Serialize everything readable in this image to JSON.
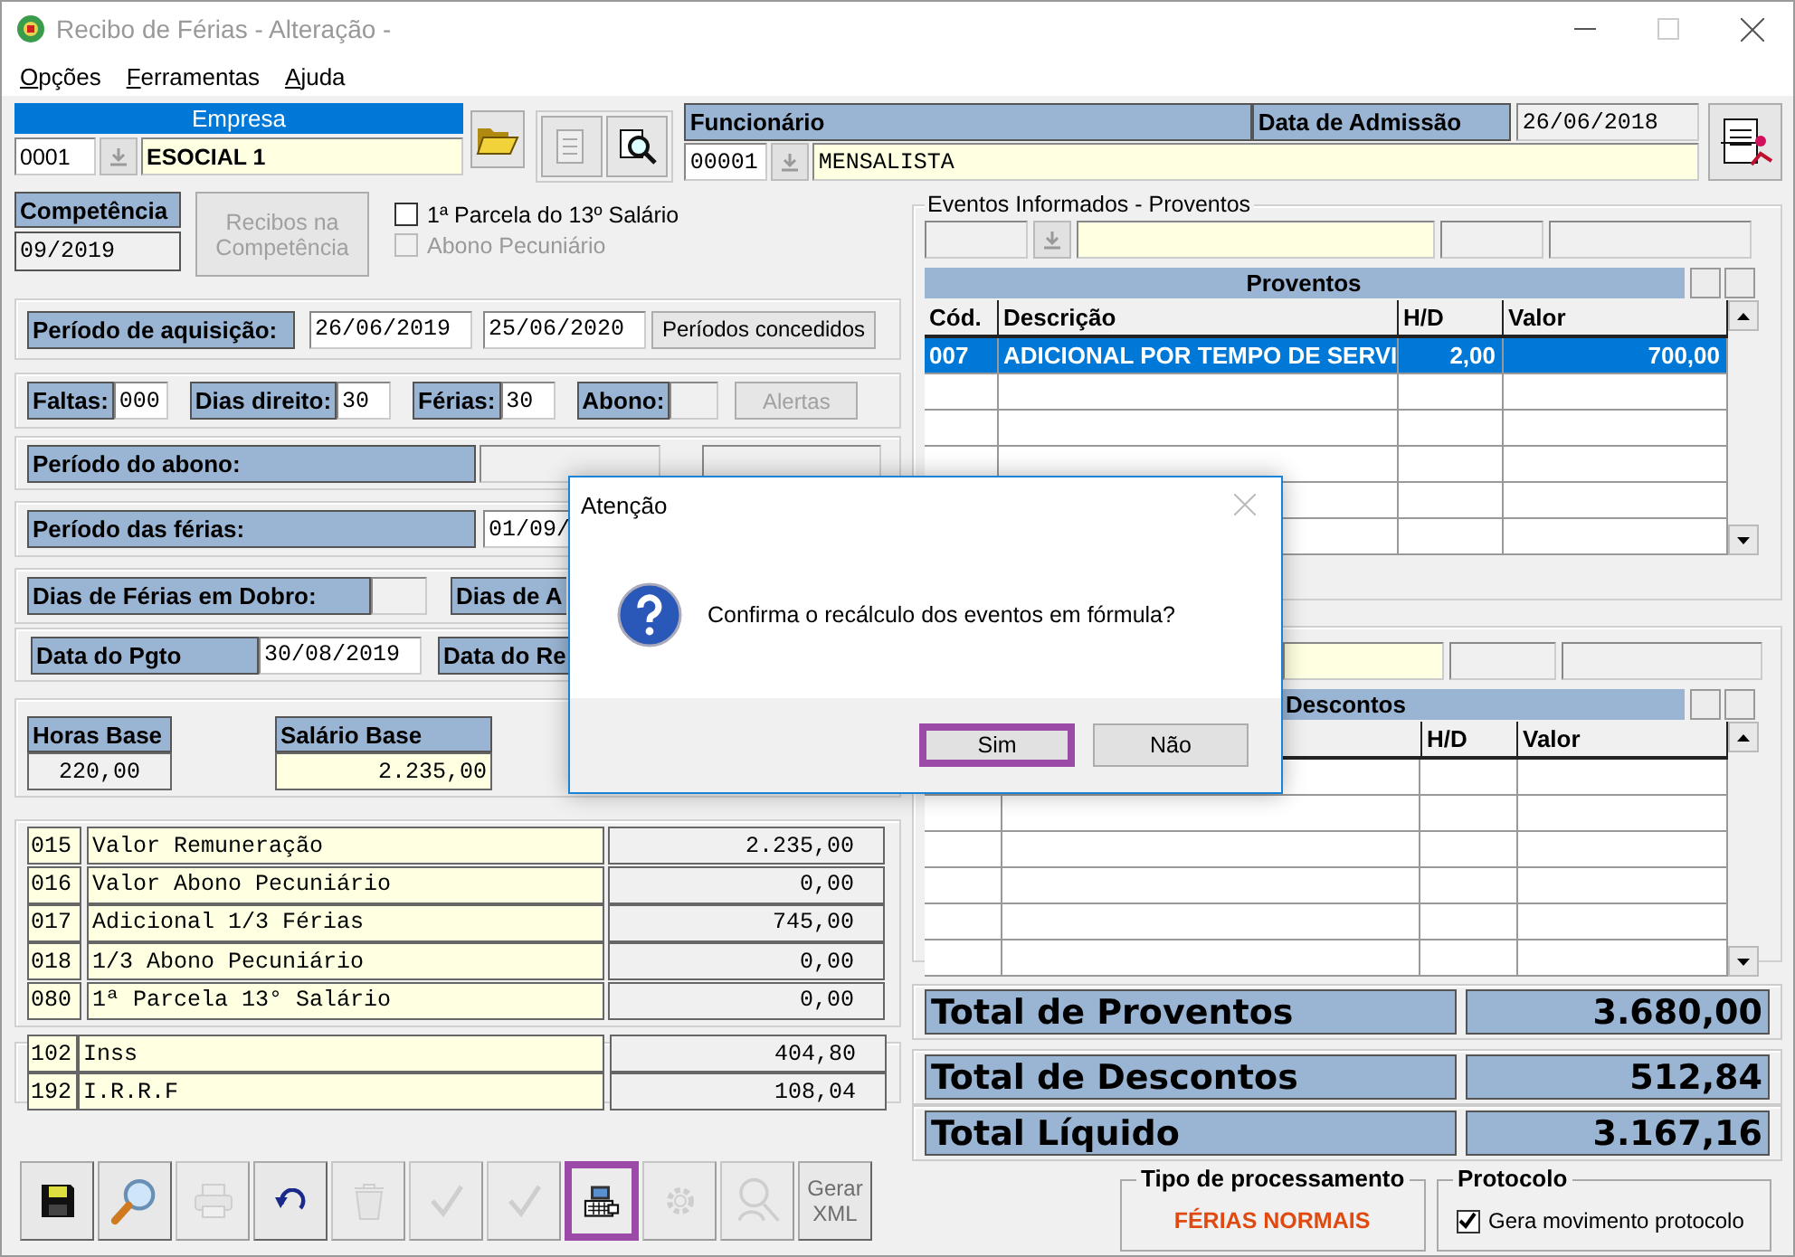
{
  "window": {
    "title": "Recibo de Férias - Alteração -"
  },
  "menu": [
    {
      "label": "Opções"
    },
    {
      "label": "Ferramentas"
    },
    {
      "label": "Ajuda"
    }
  ],
  "empresa": {
    "label": "Empresa",
    "code": "0001",
    "name": "ESOCIAL 1"
  },
  "funcionario": {
    "label": "Funcionário",
    "code": "00001",
    "name": "MENSALISTA",
    "admission_label": "Data de Admissão",
    "admission": "26/06/2018"
  },
  "competencia": {
    "label": "Competência",
    "value": "09/2019"
  },
  "recibos_button": {
    "label": "Recibos na Competência",
    "disabled": true
  },
  "options": [
    {
      "label": "1ª Parcela do 13º Salário",
      "checked": false,
      "disabled": false
    },
    {
      "label": "Abono Pecuniário",
      "checked": false,
      "disabled": true
    }
  ],
  "periodo_aquisicao": {
    "label": "Período de aquisição:",
    "start": "26/06/2019",
    "end": "25/06/2020",
    "button": "Períodos concedidos"
  },
  "dias": [
    {
      "label": "Faltas:",
      "value": "000"
    },
    {
      "label": "Dias direito:",
      "value": "30"
    },
    {
      "label": "Férias:",
      "value": "30"
    },
    {
      "label": "Abono:"
    }
  ],
  "alertas_button": {
    "label": "Alertas",
    "disabled": true
  },
  "periodo_abono": {
    "label": "Período do abono:"
  },
  "periodo_ferias": {
    "label": "Período das férias:",
    "start": "01/09/"
  },
  "dobro": {
    "label": "Dias de Férias em Dobro:",
    "label_2": "Dias de A"
  },
  "pagamento": {
    "label": "Data do Pgto",
    "value": "30/08/2019",
    "label_2": "Data do Re"
  },
  "horas_base": {
    "label": "Horas Base",
    "value": "220,00"
  },
  "salario_base": {
    "label": "Salário Base",
    "value": "2.235,00"
  },
  "proventos_list": [
    {
      "code": "015",
      "description": "Valor Remuneração",
      "value": "2.235,00"
    },
    {
      "code": "016",
      "description": "Valor Abono Pecuniário",
      "value": "0,00"
    },
    {
      "code": "017",
      "description": "Adicional 1/3 Férias",
      "value": "745,00"
    },
    {
      "code": "018",
      "description": "1/3 Abono Pecuniário",
      "value": "0,00"
    },
    {
      "code": "080",
      "description": "1ª Parcela 13° Salário",
      "value": "0,00"
    }
  ],
  "descontos_list": [
    {
      "code": "102",
      "description": "Inss",
      "value": "404,80"
    },
    {
      "code": "192",
      "description": "I.R.R.F",
      "value": "108,04"
    }
  ],
  "eventos_proventos": {
    "legend": "Eventos Informados - Proventos",
    "title": "Proventos",
    "columns": [
      "Cód.",
      "Descrição",
      "H/D",
      "Valor"
    ],
    "rows": [
      {
        "code": "007",
        "description": "ADICIONAL POR TEMPO DE SERVI",
        "hd": "2,00",
        "value": "700,00",
        "selected": true
      }
    ]
  },
  "eventos_descontos": {
    "title": "Descontos",
    "columns": [
      "H/D",
      "Valor"
    ]
  },
  "totals": [
    {
      "label": "Total de Proventos",
      "value": "3.680,00"
    },
    {
      "label": "Total de Descontos",
      "value": "512,84"
    },
    {
      "label": "Total Líquido",
      "value": "3.167,16"
    }
  ],
  "toolbar": [
    {
      "kind": "save",
      "disabled": false,
      "highlighted": false
    },
    {
      "kind": "search",
      "disabled": false,
      "highlighted": false
    },
    {
      "kind": "print",
      "disabled": true,
      "highlighted": false
    },
    {
      "kind": "undo",
      "disabled": false,
      "highlighted": false
    },
    {
      "kind": "trash",
      "disabled": true,
      "highlighted": false
    },
    {
      "kind": "check",
      "disabled": true,
      "highlighted": false
    },
    {
      "kind": "check",
      "disabled": true,
      "highlighted": false
    },
    {
      "kind": "calculate",
      "disabled": false,
      "highlighted": true
    },
    {
      "kind": "settings",
      "disabled": true,
      "highlighted": false
    },
    {
      "kind": "user_search",
      "disabled": true,
      "highlighted": false
    },
    {
      "kind": "xml",
      "label": "Gerar XML",
      "disabled": true,
      "highlighted": false
    }
  ],
  "tipo_processamento": {
    "legend": "Tipo de processamento",
    "value": "FÉRIAS NORMAIS"
  },
  "protocolo": {
    "legend": "Protocolo",
    "label": "Gera movimento protocolo",
    "checked": true
  },
  "dialog": {
    "title": "Atenção",
    "message": "Confirma o recálculo dos eventos em fórmula?",
    "buttons": [
      {
        "label": "Sim",
        "highlighted": true
      },
      {
        "label": "Não",
        "highlighted": false
      }
    ]
  }
}
